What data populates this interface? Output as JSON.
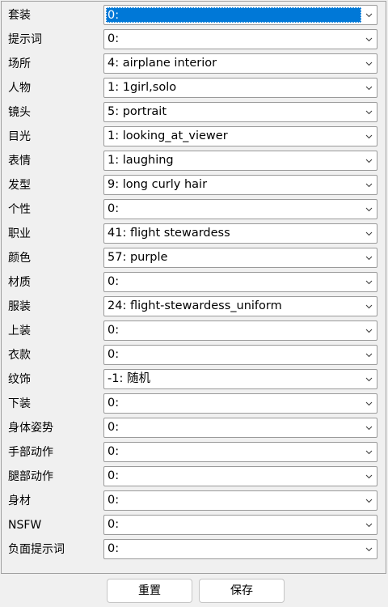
{
  "form": {
    "fields": [
      {
        "label": "套装",
        "value": "0:",
        "selected": true
      },
      {
        "label": "提示词",
        "value": "0:"
      },
      {
        "label": "场所",
        "value": "4: airplane interior"
      },
      {
        "label": "人物",
        "value": "1: 1girl,solo"
      },
      {
        "label": "镜头",
        "value": "5: portrait"
      },
      {
        "label": "目光",
        "value": "1: looking_at_viewer"
      },
      {
        "label": "表情",
        "value": "1: laughing"
      },
      {
        "label": "发型",
        "value": "9: long curly hair"
      },
      {
        "label": "个性",
        "value": "0:"
      },
      {
        "label": "职业",
        "value": "41: flight stewardess"
      },
      {
        "label": "颜色",
        "value": "57: purple"
      },
      {
        "label": "材质",
        "value": "0:"
      },
      {
        "label": "服装",
        "value": "24: flight-stewardess_uniform"
      },
      {
        "label": "上装",
        "value": "0:"
      },
      {
        "label": "衣款",
        "value": "0:"
      },
      {
        "label": "纹饰",
        "value": "-1: 随机"
      },
      {
        "label": "下装",
        "value": "0:"
      },
      {
        "label": "身体姿势",
        "value": "0:"
      },
      {
        "label": "手部动作",
        "value": "0:"
      },
      {
        "label": "腿部动作",
        "value": "0:"
      },
      {
        "label": "身材",
        "value": "0:"
      },
      {
        "label": "NSFW",
        "value": "0:"
      },
      {
        "label": "负面提示词",
        "value": "0:"
      }
    ]
  },
  "buttons": {
    "reset_label": "重置",
    "save_label": "保存"
  },
  "icons": {
    "dropdown": "chevron-down-icon"
  },
  "colors": {
    "selection": "#0078d7",
    "background": "#f0f0f0"
  }
}
